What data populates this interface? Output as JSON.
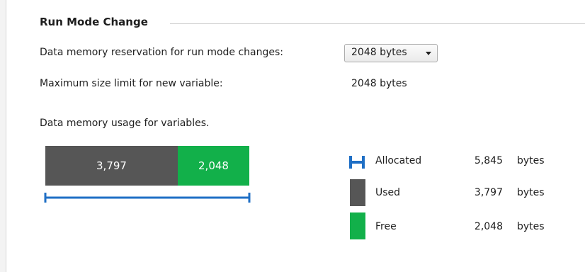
{
  "section": {
    "title": "Run Mode Change"
  },
  "reservation": {
    "label": "Data memory reservation for run mode changes:",
    "selected": "2048 bytes"
  },
  "max_size": {
    "label": "Maximum size limit for new variable:",
    "value": "2048 bytes"
  },
  "usage": {
    "label": "Data memory usage for variables.",
    "used_value": "3,797",
    "free_value": "2,048",
    "used_fraction": 0.6496,
    "free_fraction": 0.3504
  },
  "legend": {
    "items": [
      {
        "label": "Allocated",
        "value": "5,845",
        "unit": "bytes",
        "icon": "allocated-range-icon",
        "color": "#1f6fc5"
      },
      {
        "label": "Used",
        "value": "3,797",
        "unit": "bytes",
        "icon": "used-swatch",
        "color": "#565656"
      },
      {
        "label": "Free",
        "value": "2,048",
        "unit": "bytes",
        "icon": "free-swatch",
        "color": "#12b04a"
      }
    ]
  },
  "colors": {
    "used": "#565656",
    "free": "#12b04a",
    "allocated": "#1f6fc5"
  }
}
